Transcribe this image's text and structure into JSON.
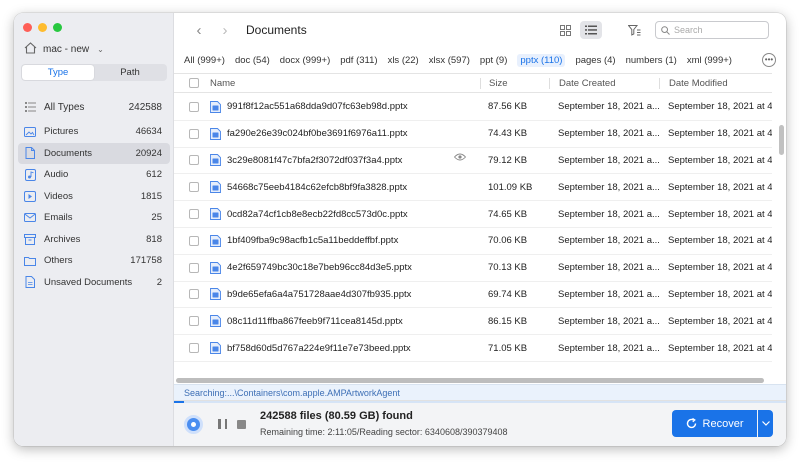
{
  "sidebar": {
    "drive_name": "mac - new",
    "segments": {
      "type": "Type",
      "path": "Path"
    },
    "all_types": {
      "label": "All Types",
      "count": "242588"
    },
    "categories": [
      {
        "label": "Pictures",
        "count": "46634",
        "icon": "picture-icon"
      },
      {
        "label": "Documents",
        "count": "20924",
        "icon": "document-icon"
      },
      {
        "label": "Audio",
        "count": "612",
        "icon": "audio-icon"
      },
      {
        "label": "Videos",
        "count": "1815",
        "icon": "video-icon"
      },
      {
        "label": "Emails",
        "count": "25",
        "icon": "email-icon"
      },
      {
        "label": "Archives",
        "count": "818",
        "icon": "archive-icon"
      },
      {
        "label": "Others",
        "count": "171758",
        "icon": "others-icon"
      },
      {
        "label": "Unsaved Documents",
        "count": "2",
        "icon": "unsaved-document-icon"
      }
    ]
  },
  "header": {
    "title": "Documents",
    "search_placeholder": "Search"
  },
  "filters": [
    "All (999+)",
    "doc (54)",
    "docx (999+)",
    "pdf (311)",
    "xls (22)",
    "xlsx (597)",
    "ppt (9)",
    "pptx (110)",
    "pages (4)",
    "numbers (1)",
    "xml (999+)"
  ],
  "table": {
    "columns": {
      "name": "Name",
      "size": "Size",
      "created": "Date Created",
      "modified": "Date Modified"
    },
    "rows": [
      {
        "name": "991f8f12ac551a68dda9d07fc63eb98d.pptx",
        "size": "87.56 KB",
        "created": "September 18, 2021 a...",
        "modified": "September 18, 2021 at 4..."
      },
      {
        "name": "fa290e26e39c024bf0be3691f6976a11.pptx",
        "size": "74.43 KB",
        "created": "September 18, 2021 a...",
        "modified": "September 18, 2021 at 4..."
      },
      {
        "name": "3c29e8081f47c7bfa2f3072df037f3a4.pptx",
        "size": "79.12 KB",
        "created": "September 18, 2021 a...",
        "modified": "September 18, 2021 at 4..."
      },
      {
        "name": "54668c75eeb4184c62efcb8bf9fa3828.pptx",
        "size": "101.09 KB",
        "created": "September 18, 2021 a...",
        "modified": "September 18, 2021 at 4..."
      },
      {
        "name": "0cd82a74cf1cb8e8ecb22fd8cc573d0c.pptx",
        "size": "74.65 KB",
        "created": "September 18, 2021 a...",
        "modified": "September 18, 2021 at 4..."
      },
      {
        "name": "1bf409fba9c98acfb1c5a11beddeffbf.pptx",
        "size": "70.06 KB",
        "created": "September 18, 2021 a...",
        "modified": "September 18, 2021 at 4..."
      },
      {
        "name": "4e2f659749bc30c18e7beb96cc84d3e5.pptx",
        "size": "70.13 KB",
        "created": "September 18, 2021 a...",
        "modified": "September 18, 2021 at 4..."
      },
      {
        "name": "b9de65efa6a4a751728aae4d307fb935.pptx",
        "size": "69.74 KB",
        "created": "September 18, 2021 a...",
        "modified": "September 18, 2021 at 4..."
      },
      {
        "name": "08c11d11ffba867feeb9f711cea8145d.pptx",
        "size": "86.15 KB",
        "created": "September 18, 2021 a...",
        "modified": "September 18, 2021 at 4..."
      },
      {
        "name": "bf758d60d5d767a224e9f11e7e73beed.pptx",
        "size": "71.05 KB",
        "created": "September 18, 2021 a...",
        "modified": "September 18, 2021 at 4..."
      }
    ]
  },
  "status": {
    "searching": "Searching:...\\Containers\\com.apple.AMPArtworkAgent",
    "found": "242588 files (80.59 GB) found",
    "remaining": "Remaining time: 2:11:05/Reading sector: 6340608/390379408",
    "progress": 0.016
  },
  "actions": {
    "recover": "Recover"
  },
  "colors": {
    "accent": "#1a73e8"
  }
}
